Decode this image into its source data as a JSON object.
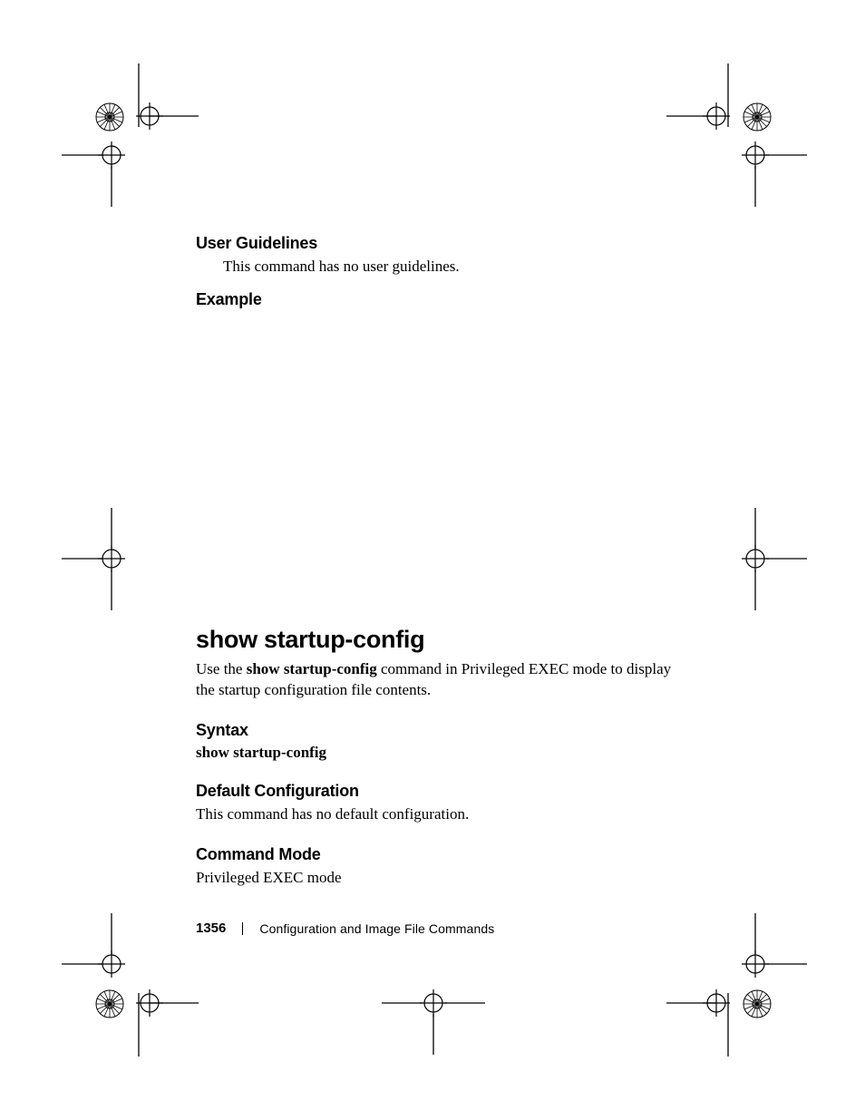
{
  "sections": {
    "user_guidelines": {
      "heading": "User Guidelines",
      "text": "This command has no user guidelines."
    },
    "example": {
      "heading": "Example"
    }
  },
  "command": {
    "title": "show startup-config",
    "description_pre": "Use the ",
    "description_bold": "show startup-config",
    "description_post": " command in Privileged EXEC mode to display the startup configuration file contents.",
    "syntax": {
      "heading": "Syntax",
      "line": "show startup-config"
    },
    "default_config": {
      "heading": "Default Configuration",
      "text": "This command has no default configuration."
    },
    "command_mode": {
      "heading": "Command Mode",
      "text": "Privileged EXEC mode"
    }
  },
  "footer": {
    "page_number": "1356",
    "chapter": "Configuration and Image File Commands"
  }
}
